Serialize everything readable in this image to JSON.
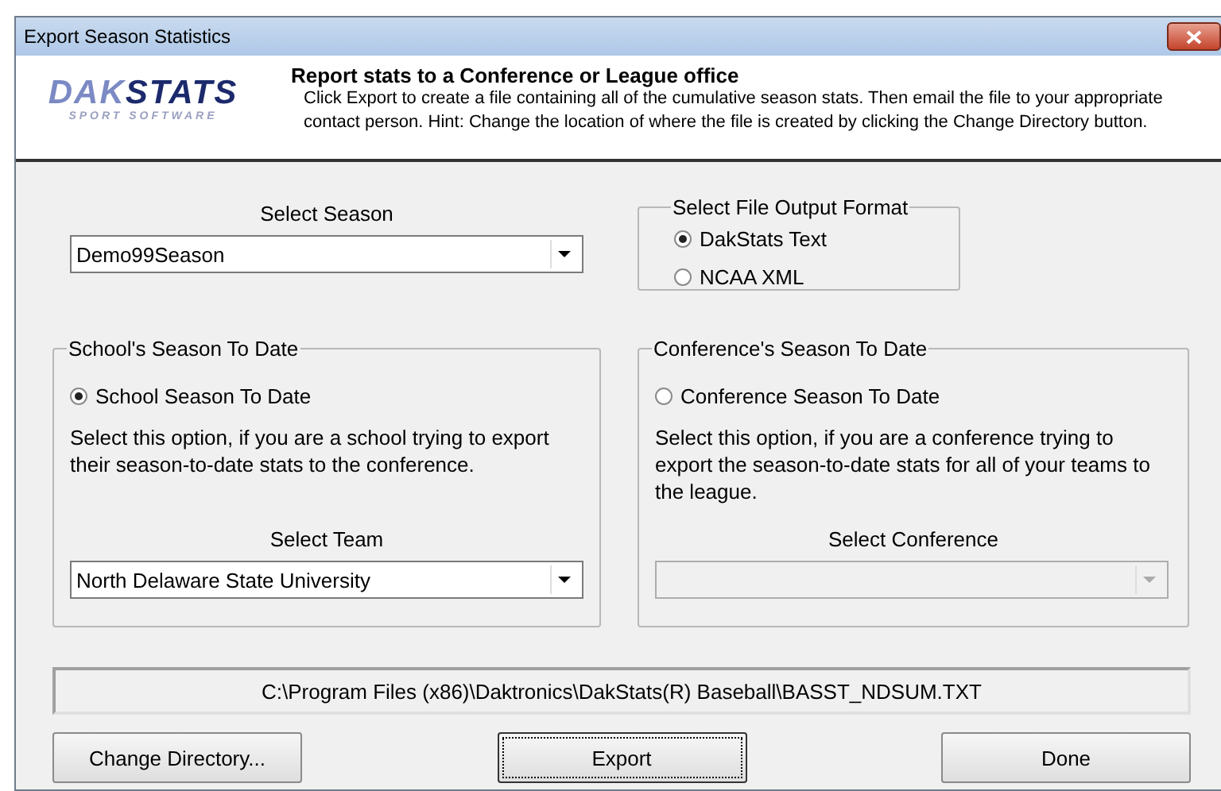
{
  "window": {
    "title": "Export Season Statistics"
  },
  "header": {
    "logo": {
      "brand_left": "DAK",
      "brand_right": "STATS",
      "tagline": "SPORT SOFTWARE"
    },
    "title": "Report stats to a Conference or League office",
    "lines": [
      "Click Export to create a file containing all of the cumulative season stats. Then email the file to your appropriate",
      "contact person.  Hint: Change the location of where the file is created by clicking the Change Directory button."
    ]
  },
  "season": {
    "label": "Select Season",
    "value": "Demo99Season",
    "disabled": false
  },
  "output_format": {
    "title": "Select File Output Format",
    "options": [
      {
        "label": "DakStats Text",
        "selected": true
      },
      {
        "label": "NCAA XML",
        "selected": false
      }
    ]
  },
  "groups": [
    {
      "title": "School's Season To Date",
      "option": {
        "label": "School Season To Date",
        "selected": true
      },
      "description": "Select this option, if you are a school trying to export their season-to-date stats to the conference.",
      "select": {
        "label": "Select Team",
        "value": "North Delaware State University",
        "disabled": false
      }
    },
    {
      "title": "Conference's Season To Date",
      "option": {
        "label": "Conference Season To Date",
        "selected": false
      },
      "description": "Select this option, if you are a conference trying to export the season-to-date stats for all of your teams to the league.",
      "select": {
        "label": "Select Conference",
        "disabled": true
      }
    }
  ],
  "path": "C:\\Program Files (x86)\\Daktronics\\DakStats(R) Baseball\\BASST_NDSUM.TXT",
  "buttons": [
    {
      "label": "Change Directory...",
      "default": false
    },
    {
      "label": "Export",
      "default": true
    },
    {
      "label": "Done",
      "default": false
    }
  ]
}
